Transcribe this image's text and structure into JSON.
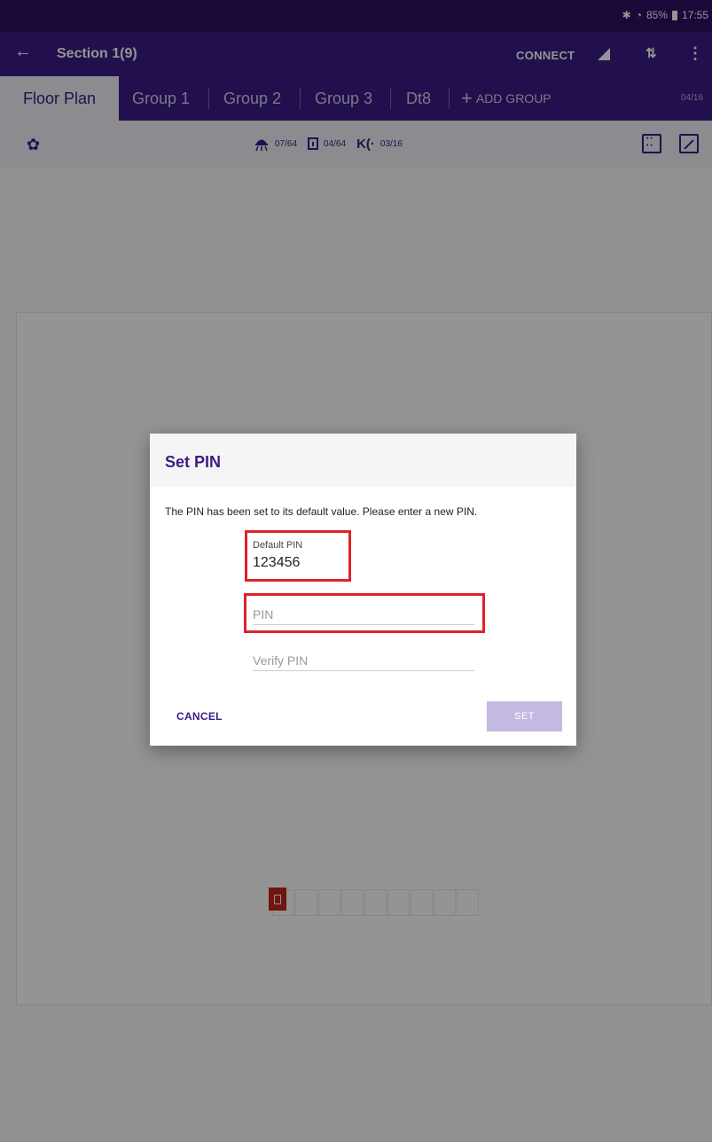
{
  "status_bar": {
    "icons": [
      "bluetooth-icon",
      "wifi-icon",
      "battery-icon"
    ],
    "battery": "85%",
    "time": "17:55"
  },
  "toolbar": {
    "back_icon": "arrow-back-icon",
    "title": "Section 1(9)",
    "connect_label": "CONNECT",
    "signal_icon": "signal-icon",
    "sort_icon": "sort-icon",
    "more_icon": "more-vert-icon"
  },
  "tabs": {
    "items": [
      {
        "label": "Floor Plan",
        "active": true
      },
      {
        "label": "Group 1"
      },
      {
        "label": "Group 2"
      },
      {
        "label": "Group 3"
      },
      {
        "label": "Dt8"
      }
    ],
    "add_group_label": "ADD GROUP",
    "group_count": "04/16"
  },
  "info_bar": {
    "settings_icon": "gear-icon",
    "luminaires": "07/64",
    "devices": "04/64",
    "sensors": "03/16",
    "grid_icon": "grid-icon",
    "resize_icon": "resize-icon"
  },
  "dialog": {
    "title": "Set PIN",
    "message": "The PIN has been set to its default value. Please enter a new PIN.",
    "default_pin_label": "Default PIN",
    "default_pin_value": "123456",
    "pin_placeholder": "PIN",
    "verify_placeholder": "Verify PIN",
    "cancel_label": "CANCEL",
    "set_label": "SET"
  },
  "colors": {
    "header": "#3a1c86",
    "status_bar": "#2a1163",
    "highlight": "#e0212a",
    "set_button_disabled": "#c3b9e2",
    "device_red": "#c0271d"
  }
}
